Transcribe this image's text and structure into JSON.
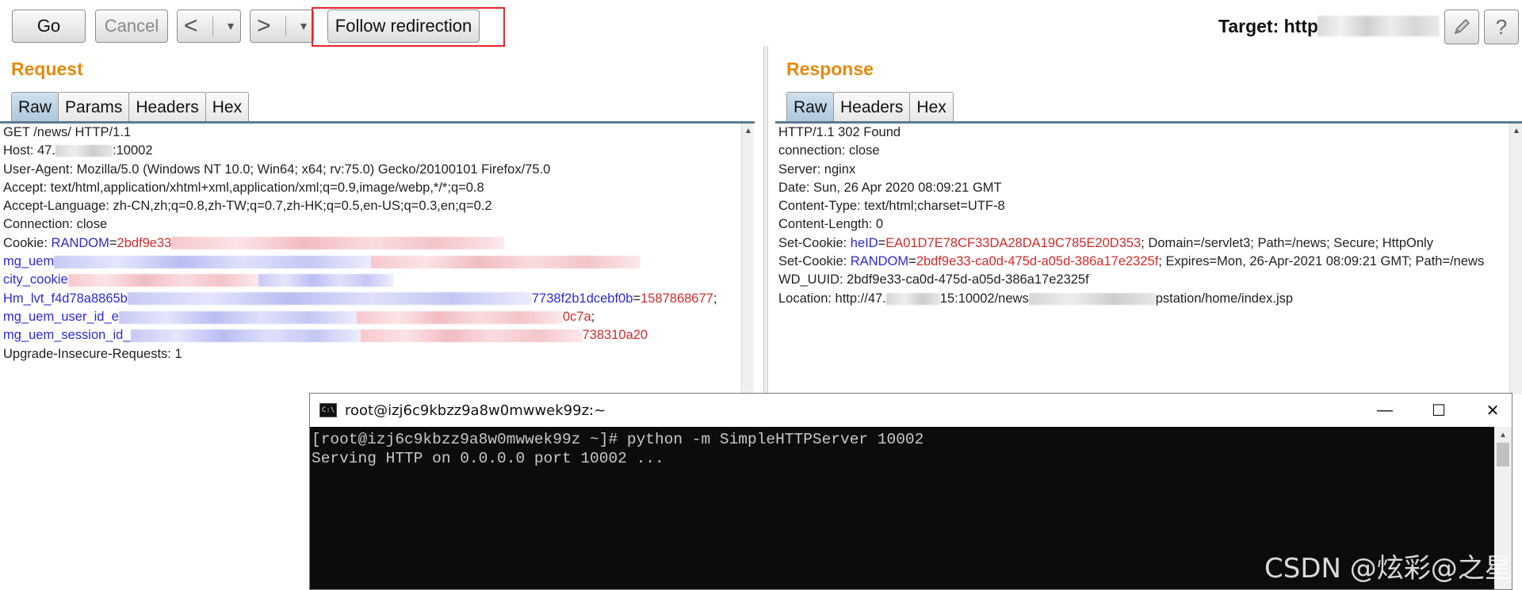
{
  "toolbar": {
    "go": "Go",
    "cancel": "Cancel",
    "back_arrow": "<",
    "forward_arrow": ">",
    "dropdown": "▾",
    "follow_redirection": "Follow redirection",
    "target_label": "Target: http:",
    "edit_icon": "pencil-icon",
    "help": "?"
  },
  "request": {
    "title": "Request",
    "tabs": [
      "Raw",
      "Params",
      "Headers",
      "Hex"
    ],
    "active_tab": "Raw",
    "lines": {
      "l1": "GET /news/ HTTP/1.1",
      "l2a": "Host: 47.",
      "l2b": ":10002",
      "l3": "User-Agent: Mozilla/5.0 (Windows NT 10.0; Win64; x64; rv:75.0) Gecko/20100101 Firefox/75.0",
      "l4": "Accept: text/html,application/xhtml+xml,application/xml;q=0.9,image/webp,*/*;q=0.8",
      "l5": "Accept-Language: zh-CN,zh;q=0.8,zh-TW;q=0.7,zh-HK;q=0.5,en-US;q=0.3,en;q=0.2",
      "l6": "Connection: close",
      "l7a": "Cookie: ",
      "l7k": "RANDOM",
      "l7b": "=",
      "l7v": "2bdf9e33",
      "l8k": "mg_uem",
      "l9k": "city_cookie",
      "l10k": "Hm_lvt_f4d78a8865b",
      "l10k2": "7738f2b1dcebf0b",
      "l10eq": "=",
      "l10v": "1587868677",
      "l10end": ";",
      "l11k": "mg_uem_user_id_e",
      "l11v": "0c7a",
      "l11end": ";",
      "l12k": "mg_uem_session_id_",
      "l12v": "738310a20",
      "l13": "Upgrade-Insecure-Requests: 1"
    }
  },
  "response": {
    "title": "Response",
    "tabs": [
      "Raw",
      "Headers",
      "Hex"
    ],
    "active_tab": "Raw",
    "lines": {
      "l1": "HTTP/1.1 302 Found",
      "l2": "connection: close",
      "l3": "Server: nginx",
      "l4": "Date: Sun, 26 Apr 2020 08:09:21 GMT",
      "l5": "Content-Type: text/html;charset=UTF-8",
      "l6": "Content-Length: 0",
      "l7a": "Set-Cookie: ",
      "l7k": "heID",
      "l7eq": "=",
      "l7v": "EA01D7E78CF33DA28DA19C785E20D353",
      "l7b": "; Domain=/servlet3; Path=/news; Secure; HttpOnly",
      "l8a": "Set-Cookie: ",
      "l8k": "RANDOM",
      "l8eq": "=",
      "l8v": "2bdf9e33-ca0d-475d-a05d-386a17e2325f",
      "l8b": "; Expires=Mon, 26-Apr-2021 08:09:21 GMT; Path=/news",
      "l9": "WD_UUID: 2bdf9e33-ca0d-475d-a05d-386a17e2325f",
      "l10a": "Location: http://47.",
      "l10b": "15:10002/news",
      "l10c": "pstation/home/index.jsp"
    }
  },
  "terminal": {
    "icon_text": "C:\\",
    "title": "root@izj6c9kbzz9a8w0mwwek99z:~",
    "minimize": "—",
    "maximize": "☐",
    "close": "✕",
    "lines": [
      "[root@izj6c9kbzz9a8w0mwwek99z ~]# python -m SimpleHTTPServer 10002",
      "Serving HTTP on 0.0.0.0 port 10002 ..."
    ]
  },
  "watermark": "CSDN @炫彩@之星"
}
